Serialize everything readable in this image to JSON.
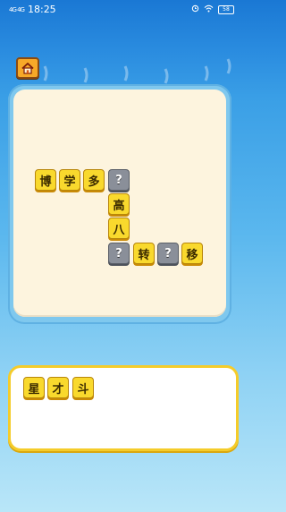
{
  "status_bar": {
    "signal": "4G 4G",
    "time": "18:25",
    "icons": [
      "alarm-icon",
      "wifi-icon",
      "battery-icon"
    ],
    "battery": "58"
  },
  "home_button": {
    "icon": "house-icon"
  },
  "board": {
    "tiles": [
      {
        "char": "博",
        "type": "letter"
      },
      {
        "char": "学",
        "type": "letter"
      },
      {
        "char": "多",
        "type": "letter"
      },
      {
        "char": "?",
        "type": "blank"
      },
      {
        "char": "高",
        "type": "letter"
      },
      {
        "char": "八",
        "type": "letter"
      },
      {
        "char": "?",
        "type": "blank"
      },
      {
        "char": "转",
        "type": "letter"
      },
      {
        "char": "?",
        "type": "blank"
      },
      {
        "char": "移",
        "type": "letter"
      }
    ]
  },
  "candidates": [
    "星",
    "才",
    "斗"
  ],
  "colors": {
    "tile_yellow": "#f9d92d",
    "tile_blank": "#8a8f99",
    "board_bg": "#fdf4de",
    "frame_blue": "#7fc8ee",
    "answer_border": "#f5cc2a"
  }
}
